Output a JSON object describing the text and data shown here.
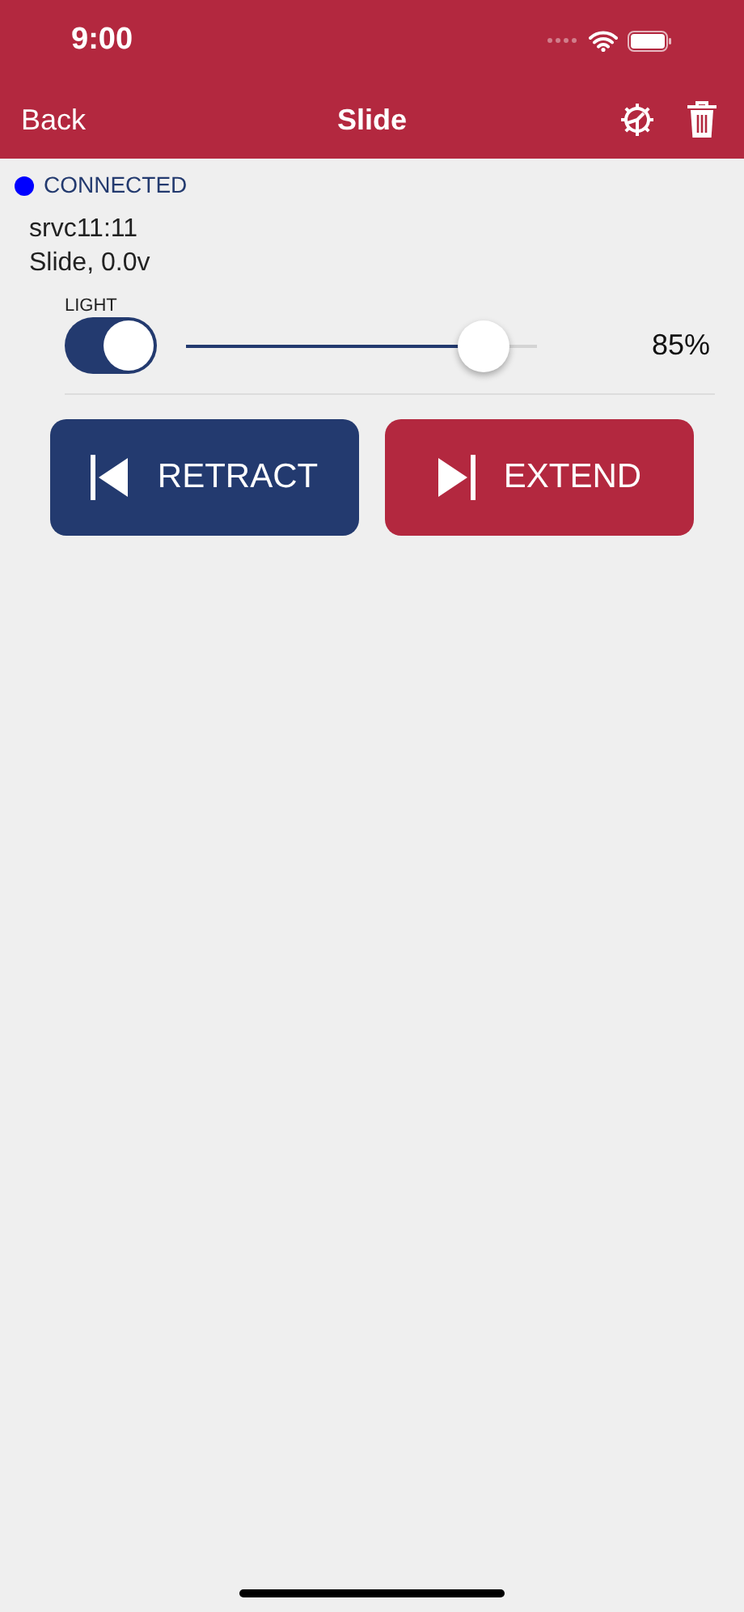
{
  "status_bar": {
    "time": "9:00"
  },
  "nav": {
    "back": "Back",
    "title": "Slide"
  },
  "connection": {
    "label": "CONNECTED",
    "connected": true
  },
  "device": {
    "name": "srvc11:11",
    "info": "Slide, 0.0v"
  },
  "light": {
    "label": "LIGHT",
    "on": true,
    "level": 0.85,
    "reading": "85%"
  },
  "buttons": [
    {
      "kind": "retract",
      "label": "RETRACT"
    },
    {
      "kind": "extend",
      "label": "EXTEND"
    }
  ]
}
